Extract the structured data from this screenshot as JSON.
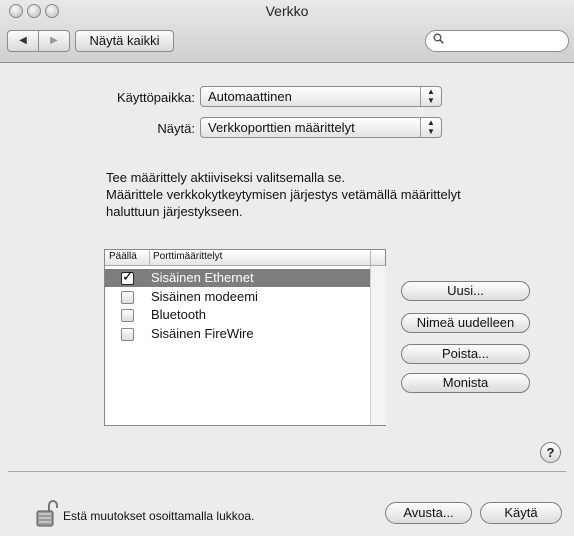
{
  "window": {
    "title": "Verkko"
  },
  "toolbar": {
    "back_icon": "◀",
    "forward_icon": "▶",
    "show_all_label": "Näytä kaikki",
    "search_placeholder": ""
  },
  "form": {
    "location_label": "Käyttöpaikka:",
    "location_value": "Automaattinen",
    "show_label": "Näytä:",
    "show_value": "Verkkoporttien määrittelyt"
  },
  "instructions": [
    "Tee määrittely aktiiviseksi valitsemalla se.",
    "Määrittele verkkokytkeytymisen järjestys vetämällä määrittelyt",
    "haluttuun järjestykseen."
  ],
  "port_list": {
    "headers": {
      "on": "Päällä",
      "config": "Porttimäärittelyt"
    },
    "items": [
      {
        "label": "Sisäinen Ethernet",
        "checked": true,
        "selected": true
      },
      {
        "label": "Sisäinen modeemi",
        "checked": false,
        "selected": false
      },
      {
        "label": "Bluetooth",
        "checked": false,
        "selected": false
      },
      {
        "label": "Sisäinen FireWire",
        "checked": false,
        "selected": false
      }
    ]
  },
  "actions": {
    "new": "Uusi...",
    "rename": "Nimeä uudelleen",
    "delete": "Poista...",
    "duplicate": "Monista"
  },
  "footer": {
    "help": "?",
    "lock_message": "Estä muutokset osoittamalla lukkoa.",
    "assist": "Avusta...",
    "apply": "Käytä"
  },
  "colors": {
    "selection": "#7d7d7d",
    "window_bg": "#ececec"
  }
}
